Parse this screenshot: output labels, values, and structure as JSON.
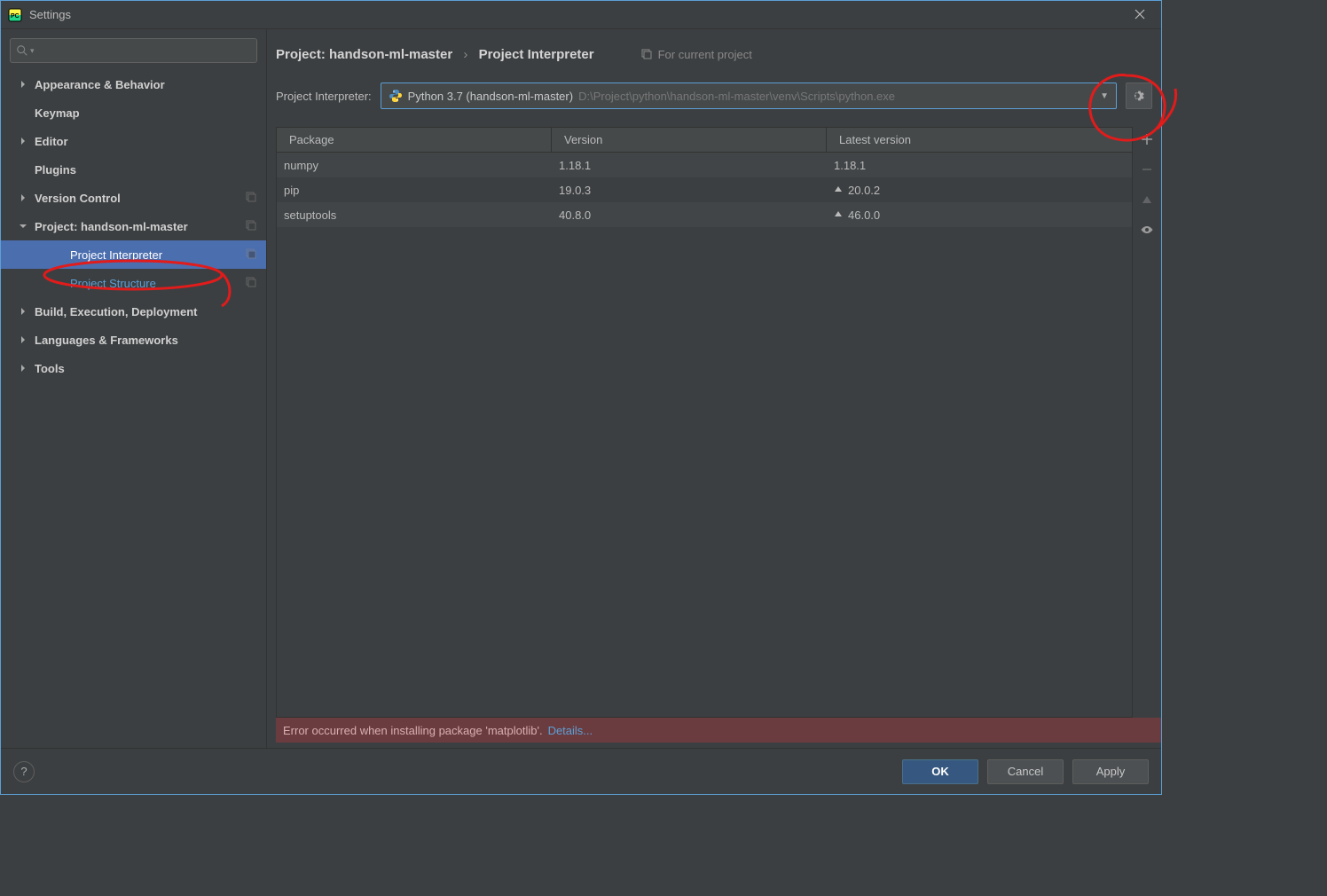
{
  "window": {
    "title": "Settings"
  },
  "sidebar": {
    "items": [
      {
        "label": "Appearance & Behavior",
        "bold": true,
        "expandable": true,
        "expanded": false
      },
      {
        "label": "Keymap",
        "bold": true,
        "expandable": false
      },
      {
        "label": "Editor",
        "bold": true,
        "expandable": true,
        "expanded": false
      },
      {
        "label": "Plugins",
        "bold": true,
        "expandable": false
      },
      {
        "label": "Version Control",
        "bold": true,
        "expandable": true,
        "expanded": false,
        "ext": true
      },
      {
        "label": "Project: handson-ml-master",
        "bold": true,
        "expandable": true,
        "expanded": true,
        "ext": true
      },
      {
        "label": "Project Interpreter",
        "child": true,
        "selected": true,
        "ext": true
      },
      {
        "label": "Project Structure",
        "child": true,
        "link": true,
        "ext": true
      },
      {
        "label": "Build, Execution, Deployment",
        "bold": true,
        "expandable": true,
        "expanded": false
      },
      {
        "label": "Languages & Frameworks",
        "bold": true,
        "expandable": true,
        "expanded": false
      },
      {
        "label": "Tools",
        "bold": true,
        "expandable": true,
        "expanded": false
      }
    ]
  },
  "breadcrumb": {
    "seg1": "Project: handson-ml-master",
    "seg2": "Project Interpreter",
    "scope": "For current project"
  },
  "interpreter": {
    "label": "Project Interpreter:",
    "name": "Python 3.7 (handson-ml-master)",
    "path": "D:\\Project\\python\\handson-ml-master\\venv\\Scripts\\python.exe"
  },
  "table": {
    "headers": {
      "c1": "Package",
      "c2": "Version",
      "c3": "Latest version"
    },
    "rows": [
      {
        "pkg": "numpy",
        "ver": "1.18.1",
        "latest": "1.18.1",
        "upgrade": false
      },
      {
        "pkg": "pip",
        "ver": "19.0.3",
        "latest": "20.0.2",
        "upgrade": true
      },
      {
        "pkg": "setuptools",
        "ver": "40.8.0",
        "latest": "46.0.0",
        "upgrade": true
      }
    ]
  },
  "error": {
    "text": "Error occurred when installing package 'matplotlib'.",
    "link": "Details..."
  },
  "footer": {
    "ok": "OK",
    "cancel": "Cancel",
    "apply": "Apply",
    "help": "?"
  }
}
